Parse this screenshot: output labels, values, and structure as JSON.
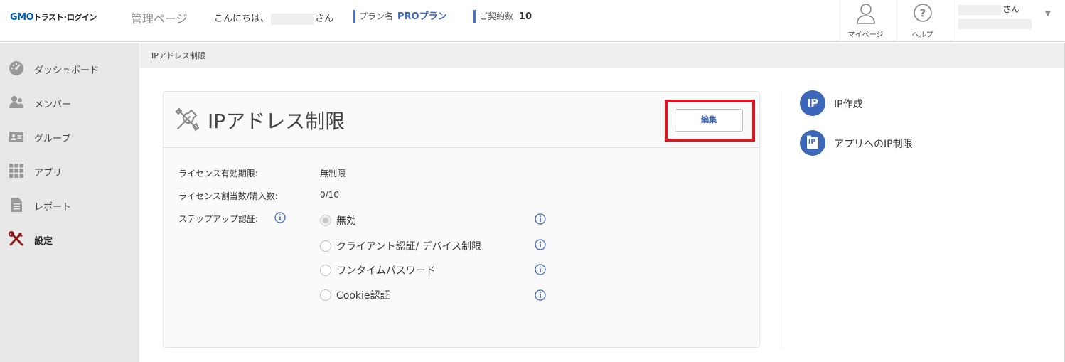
{
  "header": {
    "logo_gmo": "GMO",
    "logo_rest": "トラスト･ログイン",
    "admin_title": "管理ページ",
    "greeting_prefix": "こんにちは、",
    "greeting_suffix": "さん",
    "plan_label": "プラン名",
    "plan_value": "PROプラン",
    "contracts_label": "ご契約数",
    "contracts_value": "10",
    "mypage_label": "マイページ",
    "help_label": "ヘルプ",
    "user_suffix": "さん",
    "caret": "▼"
  },
  "sidebar": {
    "items": [
      {
        "label": "ダッシュボード",
        "icon": "dashboard-icon"
      },
      {
        "label": "メンバー",
        "icon": "members-icon"
      },
      {
        "label": "グループ",
        "icon": "group-icon"
      },
      {
        "label": "アプリ",
        "icon": "apps-grid-icon"
      },
      {
        "label": "レポート",
        "icon": "report-icon"
      },
      {
        "label": "設定",
        "icon": "settings-tools-icon",
        "active": true
      }
    ]
  },
  "breadcrumb": "IPアドレス制限",
  "card": {
    "title": "IPアドレス制限",
    "edit_label": "編集",
    "license_period_label": "ライセンス有効期限:",
    "license_period_value": "無制限",
    "license_count_label": "ライセンス割当数/購入数:",
    "license_count_value": "0/10",
    "stepup_label": "ステップアップ認証:",
    "options": [
      {
        "label": "無効",
        "checked": true
      },
      {
        "label": "クライアント認証/ デバイス制限",
        "checked": false
      },
      {
        "label": "ワンタイムパスワード",
        "checked": false
      },
      {
        "label": "Cookie認証",
        "checked": false
      }
    ]
  },
  "side_links": [
    {
      "badge": "IP",
      "label": "IP作成"
    },
    {
      "badge": "IP",
      "label": "アプリへのIP制限"
    }
  ],
  "colors": {
    "accent": "#3c67b9",
    "highlight": "#e0141e"
  }
}
